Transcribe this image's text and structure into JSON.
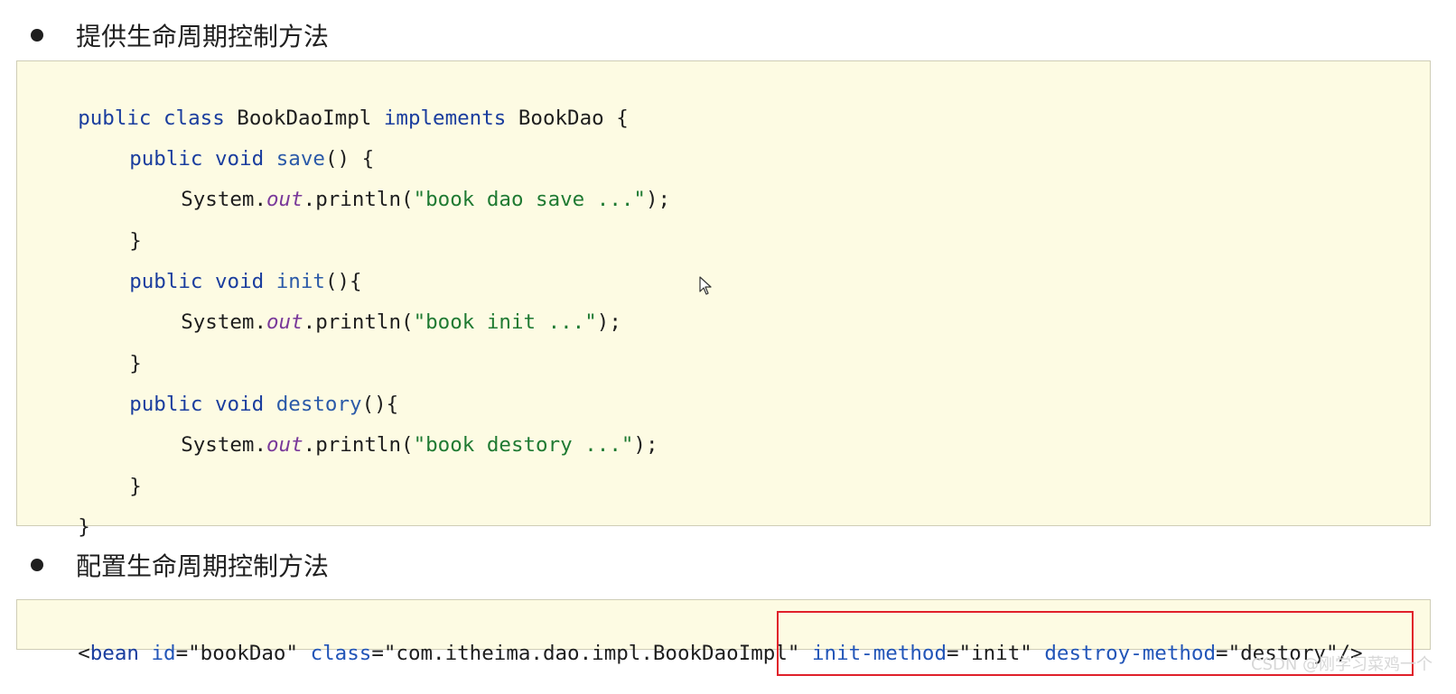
{
  "section1": {
    "heading": "提供生命周期控制方法"
  },
  "java_code": {
    "line1": {
      "kw1": "public",
      "kw2": "class",
      "name": "BookDaoImpl",
      "kw3": "implements",
      "iface": "BookDao",
      "brace": "{"
    },
    "line2": {
      "kw1": "public",
      "kw2": "void",
      "fn": "save",
      "rest": "() {"
    },
    "line3": {
      "obj": "System.",
      "field": "out",
      "call": ".println(",
      "str": "\"book dao save ...\"",
      "end": ");"
    },
    "line4": "}",
    "line5": {
      "kw1": "public",
      "kw2": "void",
      "fn": "init",
      "rest": "(){"
    },
    "line6": {
      "obj": "System.",
      "field": "out",
      "call": ".println(",
      "str": "\"book init ...\"",
      "end": ");"
    },
    "line7": "}",
    "line8": {
      "kw1": "public",
      "kw2": "void",
      "fn": "destory",
      "rest": "(){"
    },
    "line9": {
      "obj": "System.",
      "field": "out",
      "call": ".println(",
      "str": "\"book destory ...\"",
      "end": ");"
    },
    "line10": "}",
    "line11": "}"
  },
  "section2": {
    "heading": "配置生命周期控制方法"
  },
  "xml_code": {
    "open": "<",
    "tag": "bean",
    "id_attr": "id",
    "id_eq": "=",
    "id_val": "\"bookDao\"",
    "class_attr": "class",
    "class_eq": "=",
    "class_val": "\"com.itheima.dao.impl.BookDaoImpl\"",
    "init_attr": "init-method",
    "init_eq": "=",
    "init_val": "\"init\"",
    "destroy_attr": "destroy-method",
    "destroy_eq": "=",
    "destroy_val": "\"destory\"",
    "close": "/>"
  },
  "watermark": "CSDN @刚学习菜鸡一个",
  "colors": {
    "code_bg": "#fdfbe3",
    "keyword": "#1a3d9e",
    "string": "#1f7a32",
    "field": "#7a3a9a",
    "highlight": "#e0202a"
  }
}
